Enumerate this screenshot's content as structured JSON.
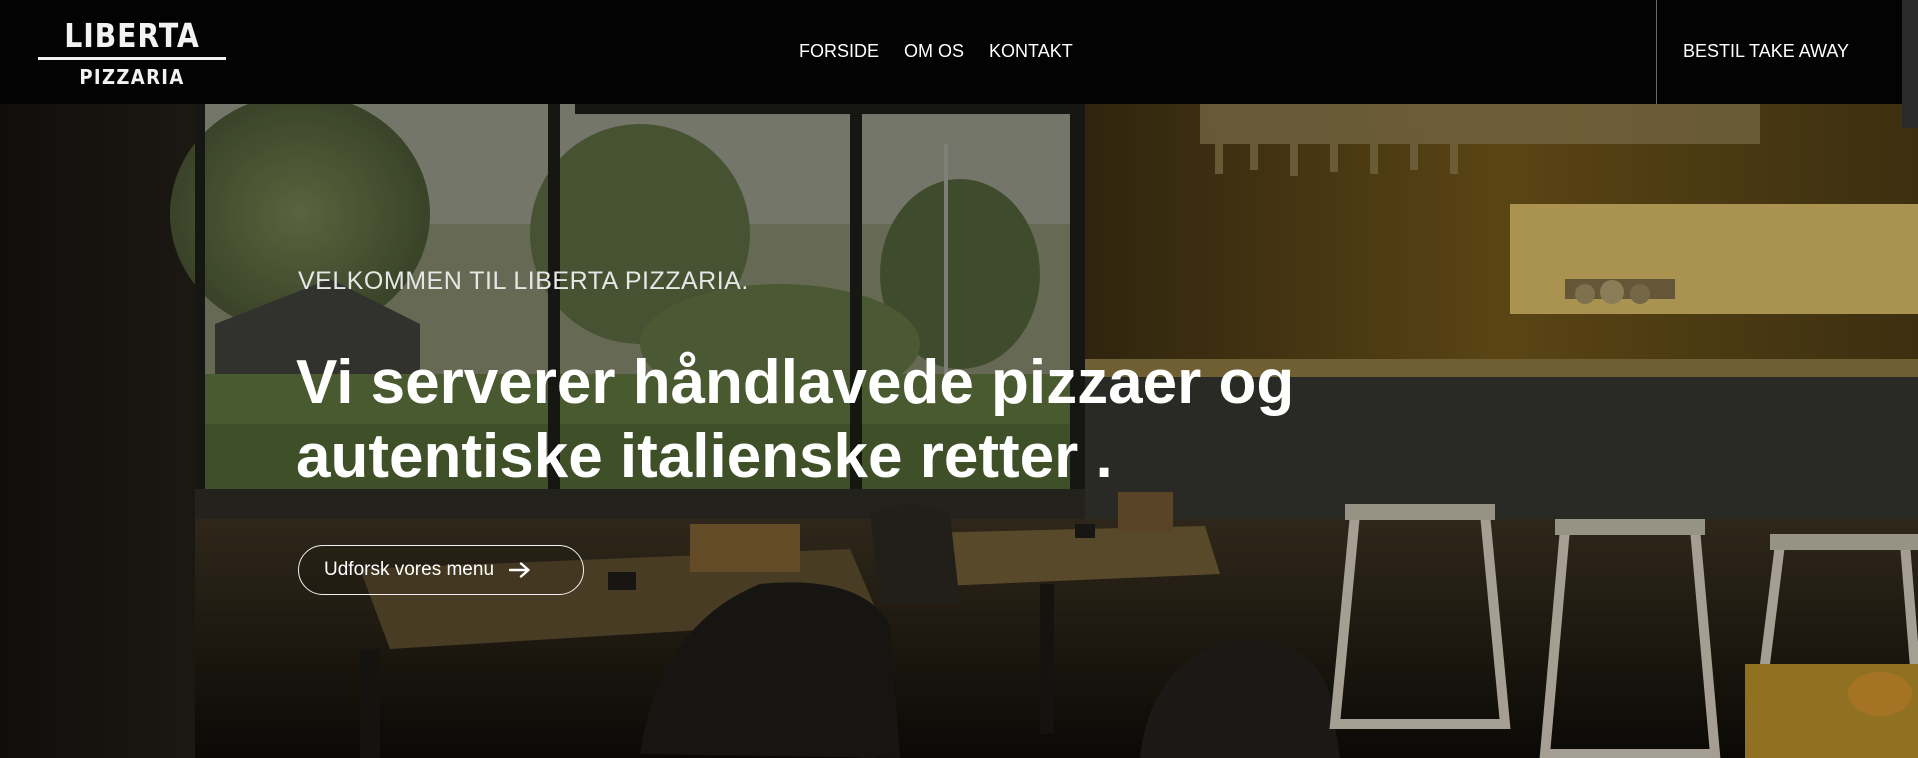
{
  "brand": {
    "name_top": "LIBERTA",
    "name_bottom": "PIZZARIA"
  },
  "nav": {
    "items": [
      {
        "label": "FORSIDE"
      },
      {
        "label": "OM OS"
      },
      {
        "label": "KONTAKT"
      }
    ]
  },
  "header_cta": {
    "label": "BESTIL TAKE AWAY"
  },
  "hero": {
    "eyebrow": "VELKOMMEN TIL LIBERTA PIZZARIA.",
    "headline_line1": "Vi serverer håndlavede pizzaer og",
    "headline_line2": "autentiske italienske retter .",
    "button_label": "Udforsk vores menu",
    "button_icon": "arrow-right-icon"
  },
  "colors": {
    "header_bg": "#030303",
    "text": "#ffffff",
    "hero_accent": "#b08a2a"
  }
}
